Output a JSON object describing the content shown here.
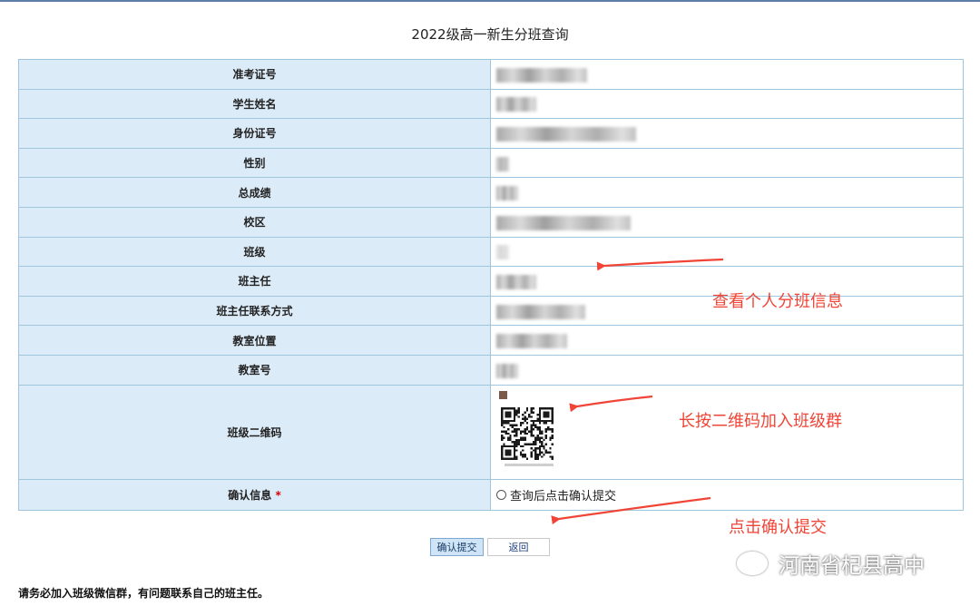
{
  "page_title": "2022级高一新生分班查询",
  "fields": [
    {
      "label": "准考证号"
    },
    {
      "label": "学生姓名"
    },
    {
      "label": "身份证号"
    },
    {
      "label": "性别"
    },
    {
      "label": "总成绩"
    },
    {
      "label": "校区"
    },
    {
      "label": "班级"
    },
    {
      "label": "班主任"
    },
    {
      "label": "班主任联系方式"
    },
    {
      "label": "教室位置"
    },
    {
      "label": "教室号"
    },
    {
      "label": "班级二维码"
    },
    {
      "label": "确认信息",
      "required_mark": "*"
    }
  ],
  "confirm_option": "查询后点击确认提交",
  "buttons": {
    "submit": "确认提交",
    "back": "返回"
  },
  "notice": "请务必加入班级微信群，有问题联系自己的班主任。",
  "annotations": {
    "view_info": "查看个人分班信息",
    "scan_qr": "长按二维码加入班级群",
    "click_submit": "点击确认提交"
  },
  "watermark": "河南省杞县高中",
  "colors": {
    "label_bg": "#dcebf8",
    "border": "#9fc6dc",
    "annotation": "#f04436",
    "required": "#d80000"
  },
  "icons": [
    "wechat-icon",
    "qr-code-icon",
    "radio-icon",
    "arrow-icon"
  ]
}
